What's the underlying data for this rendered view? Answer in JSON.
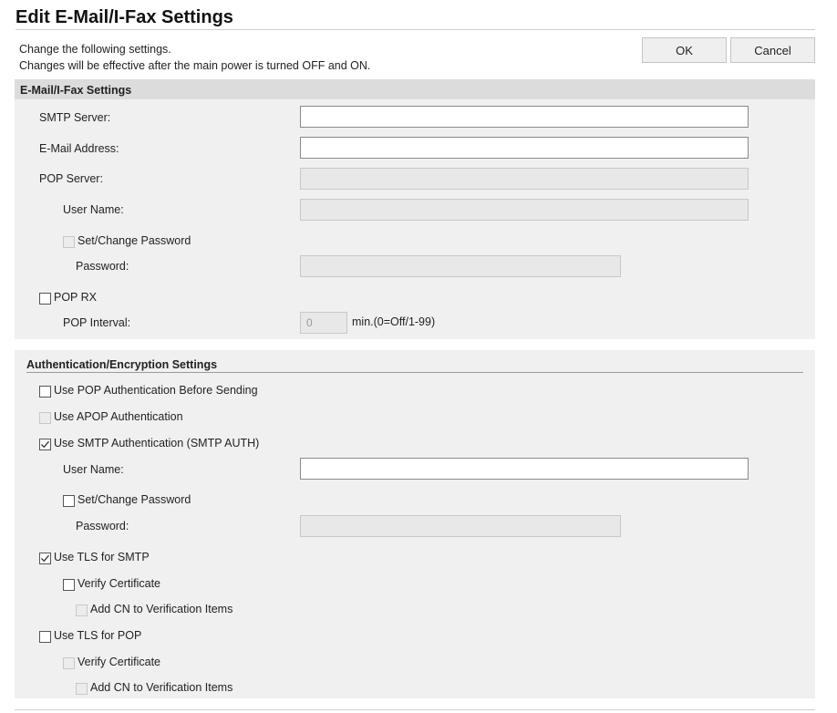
{
  "page": {
    "title": "Edit E-Mail/I-Fax Settings",
    "description_line1": "Change the following settings.",
    "description_line2": "Changes will be effective after the main power is turned OFF and ON.",
    "ok_label": "OK",
    "cancel_label": "Cancel"
  },
  "email_section": {
    "title": "E-Mail/I-Fax Settings",
    "smtp_server_label": "SMTP Server:",
    "smtp_server_value": "",
    "email_address_label": "E-Mail Address:",
    "email_address_value": "",
    "pop_server_label": "POP Server:",
    "pop_server_value": "",
    "user_name_label": "User Name:",
    "user_name_value": "",
    "set_change_password_label": "Set/Change Password",
    "set_change_password_checked": false,
    "password_label": "Password:",
    "pop_rx_label": "POP RX",
    "pop_rx_checked": false,
    "pop_interval_label": "POP Interval:",
    "pop_interval_value": "0",
    "pop_interval_unit": "min.(0=Off/1-99)"
  },
  "auth_section": {
    "title": "Authentication/Encryption Settings",
    "pop_auth_before_sending_label": "Use POP Authentication Before Sending",
    "pop_auth_before_sending_checked": false,
    "apop_auth_label": "Use APOP Authentication",
    "apop_auth_checked": false,
    "smtp_auth_label": "Use SMTP Authentication (SMTP AUTH)",
    "smtp_auth_checked": true,
    "user_name_label": "User Name:",
    "user_name_value": "",
    "set_change_password_label": "Set/Change Password",
    "set_change_password_checked": false,
    "password_label": "Password:",
    "tls_smtp_label": "Use TLS for SMTP",
    "tls_smtp_checked": true,
    "tls_smtp_verify_label": "Verify Certificate",
    "tls_smtp_verify_checked": false,
    "tls_smtp_add_cn_label": "Add CN to Verification Items",
    "tls_smtp_add_cn_checked": false,
    "tls_pop_label": "Use TLS for POP",
    "tls_pop_checked": false,
    "tls_pop_verify_label": "Verify Certificate",
    "tls_pop_verify_checked": false,
    "tls_pop_add_cn_label": "Add CN to Verification Items",
    "tls_pop_add_cn_checked": false
  }
}
